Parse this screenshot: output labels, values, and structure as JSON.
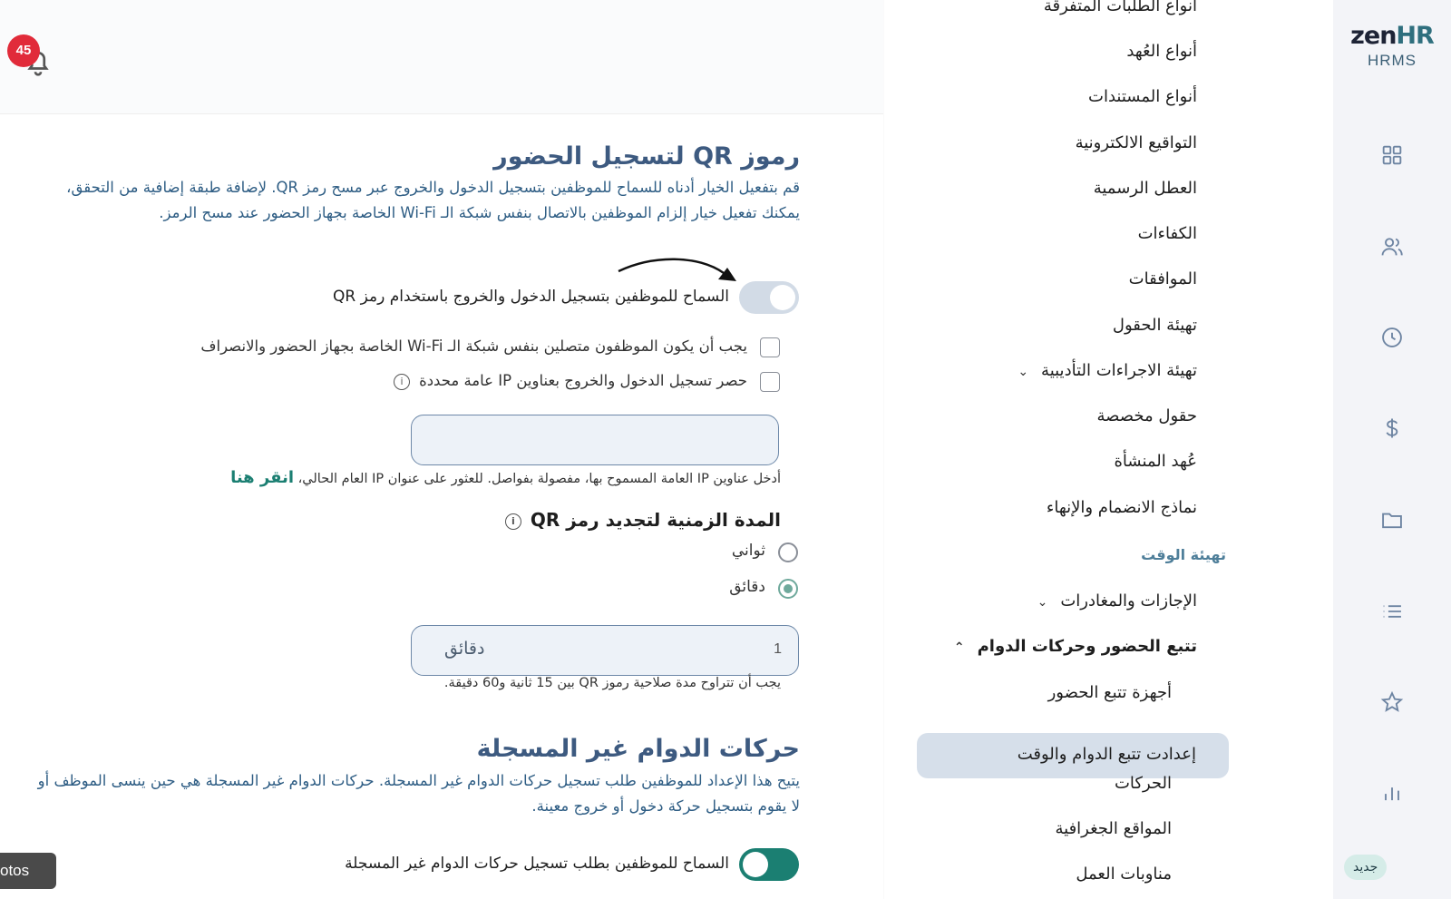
{
  "brand": {
    "logo_zen": "zen",
    "logo_hr": "HR",
    "subtitle": "HRMS"
  },
  "rail": {
    "icons": [
      "grid-icon",
      "users-icon",
      "clock-icon",
      "dollar-icon",
      "folder-icon",
      "list-icon",
      "star-icon",
      "bar-chart-icon"
    ],
    "new_badge": "جديد"
  },
  "header": {
    "notification_count": "45"
  },
  "menu": {
    "items": [
      "أنواع الطلبات المتفرقة",
      "أنواع العُهد",
      "أنواع المستندات",
      "التواقيع الالكترونية",
      "العطل الرسمية",
      "الكفاءات",
      "الموافقات",
      "تهيئة الحقول",
      "تهيئة الاجراءات التأديبية",
      "حقول مخصصة",
      "عُهد المنشأة",
      "نماذج الانضمام والإنهاء"
    ],
    "section_time": "تهيئة الوقت",
    "leaves": "الإجازات والمغادرات",
    "attendance": "تتبع الحضور وحركات الدوام",
    "devices": "أجهزة تتبع الحضور",
    "active": "إعدادت تتبع الدوام والوقت",
    "movements": "الحركات",
    "locations": "المواقع الجغرافية",
    "shifts": "مناوبات العمل"
  },
  "qr": {
    "title": "رموز QR لتسجيل الحضور",
    "description": "قم بتفعيل الخيار أدناه للسماح للموظفين بتسجيل الدخول والخروج عبر مسح رمز QR. لإضافة طبقة إضافية من التحقق، يمكنك تفعيل خيار إلزام الموظفين بالاتصال بنفس شبكة الـ Wi-Fi الخاصة بجهاز الحضور عند مسح الرمز.",
    "toggle_label": "السماح للموظفين بتسجيل الدخول والخروج باستخدام رمز QR",
    "wifi_label": "يجب أن يكون الموظفون متصلين بنفس شبكة الـ Wi-Fi الخاصة بجهاز الحضور والانصراف",
    "ip_label": "حصر تسجيل الدخول والخروج بعناوين IP عامة محددة",
    "ip_hint": "أدخل عناوين IP العامة المسموح بها، مفصولة بفواصل. للعثور على عنوان IP العام الحالي،",
    "ip_link": "انقر هنا",
    "refresh_title": "المدة الزمنية لتجديد رمز QR",
    "seconds": "ثواني",
    "minutes": "دقائق",
    "duration_value": "1",
    "duration_unit": "دقائق",
    "duration_hint": "يجب أن تتراوح مدة صلاحية رموز QR بين 15 ثانية و60 دقيقة."
  },
  "unregistered": {
    "title": "حركات الدوام غير المسجلة",
    "description": "يتيح هذا الإعداد للموظفين طلب تسجيل حركات الدوام غير المسجلة. حركات الدوام غير المسجلة هي حين ينسى الموظف أو لا يقوم بتسجيل حركة دخول أو خروج معينة.",
    "toggle_label": "السماح للموظفين بطلب تسجيل حركات الدوام غير المسجلة"
  },
  "tooltip": {
    "text": "otos"
  }
}
